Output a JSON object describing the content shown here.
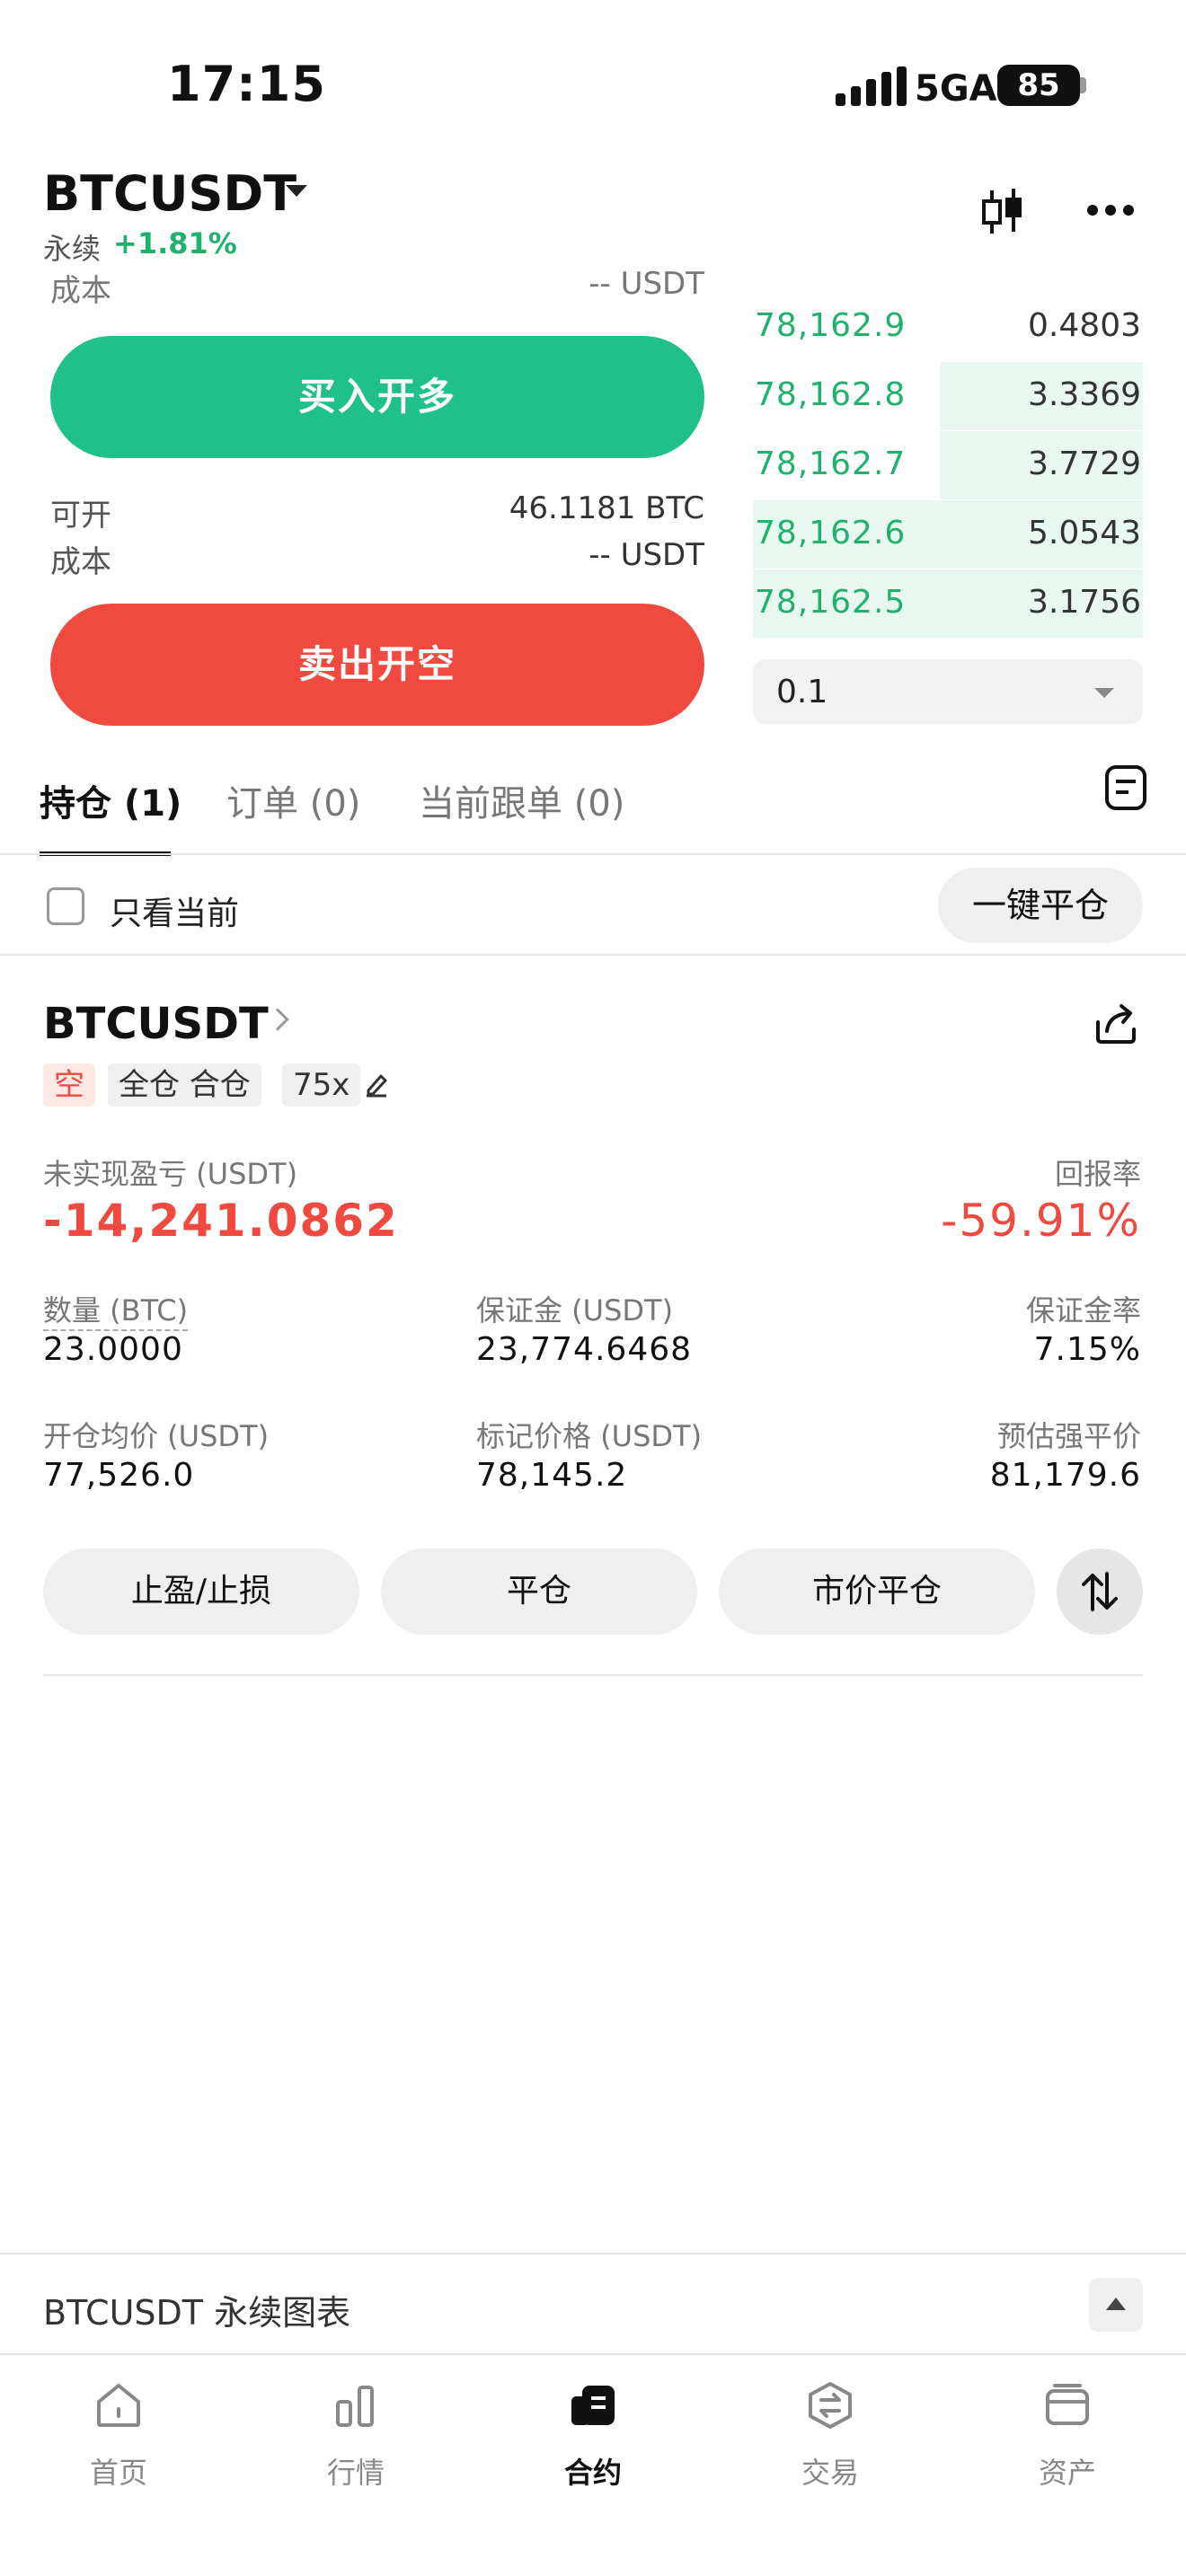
{
  "status_bar": {
    "time": "17:15",
    "network": "5GA",
    "battery": "85"
  },
  "header": {
    "pair": "BTCUSDT",
    "contract_type": "永续",
    "change": "+1.81%",
    "icons": [
      "candlestick-chart-icon",
      "more-icon"
    ]
  },
  "order_form": {
    "cost_label_top": "成本",
    "cost_value_top": "-- USDT",
    "buy_label": "买入开多",
    "available_label": "可开",
    "available_value": "46.1181 BTC",
    "cost_label": "成本",
    "cost_value": "-- USDT",
    "sell_label": "卖出开空"
  },
  "order_book": {
    "rows": [
      {
        "price": "78,162.9",
        "qty": "0.4803",
        "depth": 0.0
      },
      {
        "price": "78,162.8",
        "qty": "3.3369",
        "depth": 0.52
      },
      {
        "price": "78,162.7",
        "qty": "3.7729",
        "depth": 0.52
      },
      {
        "price": "78,162.6",
        "qty": "5.0543",
        "depth": 1.0
      },
      {
        "price": "78,162.5",
        "qty": "3.1756",
        "depth": 1.0
      }
    ],
    "depth_precision": "0.1"
  },
  "tabs": {
    "positions": "持仓 (1)",
    "orders": "订单 (0)",
    "copy_orders": "当前跟单 (0)"
  },
  "filter": {
    "current_only_label": "只看当前",
    "close_all_label": "一键平仓"
  },
  "position": {
    "symbol": "BTCUSDT",
    "side_tag": "空",
    "margin_tag": "全仓 合仓",
    "leverage_tag": "75x",
    "unrealized_pnl_label": "未实现盈亏 (USDT)",
    "unrealized_pnl_value": "-14,241.0862",
    "roi_label": "回报率",
    "roi_value": "-59.91%",
    "quantity_label": "数量 (BTC)",
    "quantity_value": "23.0000",
    "margin_label": "保证金 (USDT)",
    "margin_value": "23,774.6468",
    "margin_ratio_label": "保证金率",
    "margin_ratio_value": "7.15%",
    "entry_price_label": "开仓均价 (USDT)",
    "entry_price_value": "77,526.0",
    "mark_price_label": "标记价格 (USDT)",
    "mark_price_value": "78,145.2",
    "liq_price_label": "预估强平价",
    "liq_price_value": "81,179.6",
    "actions": {
      "tp_sl": "止盈/止损",
      "close": "平仓",
      "market_close": "市价平仓"
    }
  },
  "chart_bar": {
    "label": "BTCUSDT 永续图表"
  },
  "bottom_nav": [
    {
      "label": "首页",
      "icon": "home-icon",
      "active": false
    },
    {
      "label": "行情",
      "icon": "market-icon",
      "active": false
    },
    {
      "label": "合约",
      "icon": "futures-icon",
      "active": true
    },
    {
      "label": "交易",
      "icon": "trade-icon",
      "active": false
    },
    {
      "label": "资产",
      "icon": "wallet-icon",
      "active": false
    }
  ],
  "colors": {
    "buy": "#20c08a",
    "sell": "#f04a40",
    "positive_text": "#20b26c",
    "negative_text": "#f04a40"
  }
}
